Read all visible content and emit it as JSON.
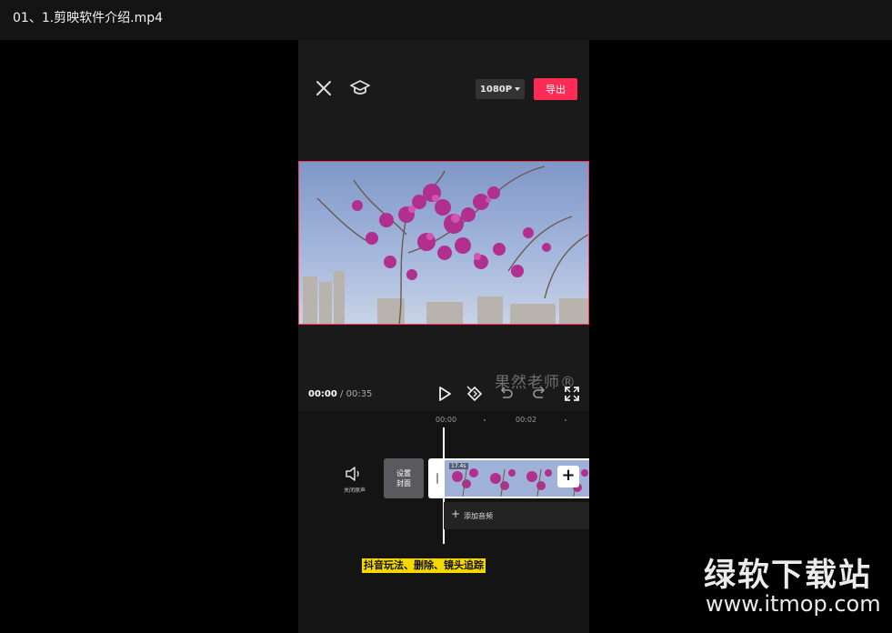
{
  "window": {
    "title": "01、1.剪映软件介绍.mp4"
  },
  "editor": {
    "resolution": "1080P",
    "export_label": "导出",
    "teacher_watermark": "果然老师®",
    "time_current": "00:00",
    "time_separator": "/",
    "time_total": "00:35"
  },
  "timeline": {
    "ruler": [
      "00:00",
      "00:02"
    ],
    "mute_label": "关闭原声",
    "cover_label_line1": "设置",
    "cover_label_line2": "封面",
    "clip_duration": "17.4s",
    "add_audio_label": "添加音频",
    "caption": "抖音玩法、删除、镜头追踪"
  },
  "site_watermark": {
    "name": "绿软下载站",
    "url": "www.itmop.com"
  },
  "colors": {
    "accent": "#fe2c55",
    "caption_bg": "#f5d800",
    "selection_border": "#ff3b64"
  }
}
